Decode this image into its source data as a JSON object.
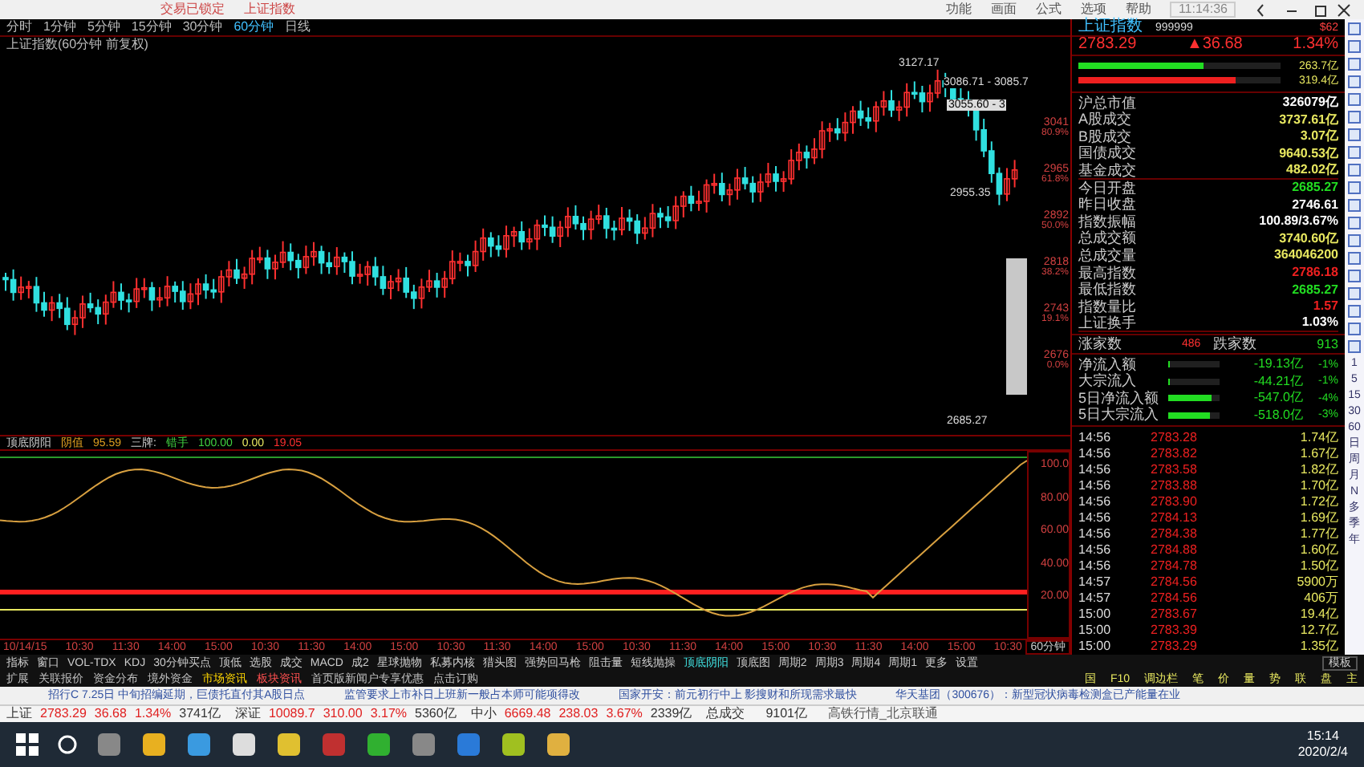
{
  "title_bar": {
    "tabs": [
      "交易已锁定",
      "上证指数"
    ],
    "menu": [
      "功能",
      "画面",
      "公式",
      "选项",
      "帮助"
    ],
    "time": "11:14:36"
  },
  "periods": [
    {
      "label": "分时",
      "selected": false
    },
    {
      "label": "1分钟",
      "selected": false
    },
    {
      "label": "5分钟",
      "selected": false
    },
    {
      "label": "15分钟",
      "selected": false
    },
    {
      "label": "30分钟",
      "selected": false
    },
    {
      "label": "60分钟",
      "selected": true
    },
    {
      "label": "日线",
      "selected": false
    }
  ],
  "chart": {
    "title": "上证指数(60分钟 前复权)",
    "annotations": [
      "3127.17",
      "3086.71 - 3085.7",
      "3055.60 - 3",
      "2955.35",
      "2685.27"
    ],
    "levels": [
      {
        "price": "3041",
        "pct": "80.9%"
      },
      {
        "price": "2965",
        "pct": "61.8%"
      },
      {
        "price": "2892",
        "pct": "50.0%"
      },
      {
        "price": "2818",
        "pct": "38.2%"
      },
      {
        "price": "2743",
        "pct": "19.1%"
      },
      {
        "price": "2676",
        "pct": "0.0%"
      }
    ]
  },
  "indicator": {
    "name": "顶底阴阳",
    "items": [
      "阴值",
      "95.59",
      "三牌:",
      "错手",
      "100.00",
      "0.00",
      "19.05"
    ],
    "axis": [
      "100.0",
      "80.00",
      "60.00",
      "40.00",
      "20.00"
    ]
  },
  "time_axis": {
    "labels": [
      "10/14/15",
      "10:30",
      "11:30",
      "14:00",
      "15:00",
      "10:30",
      "11:30",
      "14:00",
      "15:00",
      "10:30",
      "11:30",
      "14:00",
      "15:00",
      "10:30",
      "11:30",
      "14:00",
      "15:00",
      "10:30",
      "11:30",
      "14:00",
      "15:00",
      "10:30"
    ],
    "period": "60分钟",
    "mode": "模板"
  },
  "indicator_tabs": [
    {
      "label": "指标",
      "selected": false
    },
    {
      "label": "窗口",
      "selected": false
    },
    {
      "label": "VOL-TDX",
      "selected": false
    },
    {
      "label": "KDJ",
      "selected": false
    },
    {
      "label": "30分钟买点",
      "selected": false
    },
    {
      "label": "顶低",
      "selected": false
    },
    {
      "label": "选股",
      "selected": false
    },
    {
      "label": "成交",
      "selected": false
    },
    {
      "label": "MACD",
      "selected": false
    },
    {
      "label": "成2",
      "selected": false
    },
    {
      "label": "星球抛物",
      "selected": false
    },
    {
      "label": "私募内核",
      "selected": false
    },
    {
      "label": "猎头图",
      "selected": false
    },
    {
      "label": "强势回马枪",
      "selected": false
    },
    {
      "label": "阻击量",
      "selected": false
    },
    {
      "label": "短线抛操",
      "selected": false
    },
    {
      "label": "顶底阴阳",
      "selected": true
    },
    {
      "label": "顶底图",
      "selected": false
    },
    {
      "label": "周期2",
      "selected": false
    },
    {
      "label": "周期3",
      "selected": false
    },
    {
      "label": "周期4",
      "selected": false
    },
    {
      "label": "周期1",
      "selected": false
    },
    {
      "label": "更多",
      "selected": false
    },
    {
      "label": "设置",
      "selected": false
    }
  ],
  "extension_row": [
    {
      "label": "扩展",
      "color": "#c0c0c0"
    },
    {
      "label": "关联报价",
      "color": "#c0c0c0"
    },
    {
      "label": "资金分布",
      "color": "#c0c0c0"
    },
    {
      "label": "境外资金",
      "color": "#c0c0c0"
    },
    {
      "label": "市场资讯",
      "color": "#ffd700"
    },
    {
      "label": "板块资讯",
      "color": "#ff5050"
    },
    {
      "label": "首页版新闻户专享优惠",
      "color": "#c0c0c0"
    },
    {
      "label": "点击订购",
      "color": "#c0c0c0"
    }
  ],
  "f10_tabs": [
    "国",
    "F10",
    "调边栏",
    "笔",
    "价",
    "量",
    "势",
    "联",
    "盘",
    "主"
  ],
  "news": [
    "招行C 7.25日 中旬招编延期，巨债托直付其A股日点",
    "监管要求上市补日上班新一般占本师可能项得改",
    "国家开安：前元初行中上 影搜财和所现需求最快",
    "华天基团（300676）：新型冠状病毒检测盒已产能量在业"
  ],
  "quote": {
    "name": "上证指数",
    "code": "999999",
    "tag": "$62",
    "price": "2783.29",
    "change": "▲36.68",
    "pct": "1.34%"
  },
  "flow_bars": [
    {
      "value": "263.7亿",
      "level": 0.62,
      "color": "#22dd22"
    },
    {
      "value": "319.4亿",
      "level": 0.78,
      "color": "#ee2020"
    }
  ],
  "stats": [
    {
      "label": "沪总市值",
      "value": "326079亿",
      "color": "#ffffff"
    },
    {
      "label": "A股成交",
      "value": "3737.61亿",
      "color": "#e8e860"
    },
    {
      "label": "B股成交",
      "value": "3.07亿",
      "color": "#e8e860"
    },
    {
      "label": "国债成交",
      "value": "9640.53亿",
      "color": "#e8e860"
    },
    {
      "label": "基金成交",
      "value": "482.02亿",
      "color": "#e8e860"
    },
    {
      "label": "今日开盘",
      "value": "2685.27",
      "color": "#22dd22"
    },
    {
      "label": "昨日收盘",
      "value": "2746.61",
      "color": "#ffffff"
    },
    {
      "label": "指数振幅",
      "value": "100.89/3.67%",
      "color": "#ffffff"
    },
    {
      "label": "总成交额",
      "value": "3740.60亿",
      "color": "#e8e860"
    },
    {
      "label": "总成交量",
      "value": "364046200",
      "color": "#e8e860"
    },
    {
      "label": "最高指数",
      "value": "2786.18",
      "color": "#ee2020"
    },
    {
      "label": "最低指数",
      "value": "2685.27",
      "color": "#22dd22"
    },
    {
      "label": "指数量比",
      "value": "1.57",
      "color": "#ee2020"
    },
    {
      "label": "上证换手",
      "value": "1.03%",
      "color": "#ffffff"
    }
  ],
  "breadth": {
    "up_label": "涨家数",
    "up": "486",
    "down_label": "跌家数",
    "down": "913"
  },
  "flows": [
    {
      "label": "净流入额",
      "value": "-19.13亿",
      "pct": "-1%",
      "level": 0.01
    },
    {
      "label": "大宗流入",
      "value": "-44.21亿",
      "pct": "-1%",
      "level": 0.03
    },
    {
      "label": "5日净流入额",
      "value": "-547.0亿",
      "pct": "-4%",
      "level": 0.85
    },
    {
      "label": "5日大宗流入",
      "value": "-518.0亿",
      "pct": "-3%",
      "level": 0.8
    }
  ],
  "ticks": [
    {
      "time": "14:56",
      "price": "2783.28",
      "volume": "1.74亿"
    },
    {
      "time": "14:56",
      "price": "2783.82",
      "volume": "1.67亿"
    },
    {
      "time": "14:56",
      "price": "2783.58",
      "volume": "1.82亿"
    },
    {
      "time": "14:56",
      "price": "2783.88",
      "volume": "1.70亿"
    },
    {
      "time": "14:56",
      "price": "2783.90",
      "volume": "1.72亿"
    },
    {
      "time": "14:56",
      "price": "2784.13",
      "volume": "1.69亿"
    },
    {
      "time": "14:56",
      "price": "2784.38",
      "volume": "1.77亿"
    },
    {
      "time": "14:56",
      "price": "2784.88",
      "volume": "1.60亿"
    },
    {
      "time": "14:56",
      "price": "2784.78",
      "volume": "1.50亿"
    },
    {
      "time": "14:57",
      "price": "2784.56",
      "volume": "5900万"
    },
    {
      "time": "14:57",
      "price": "2784.56",
      "volume": "406万"
    },
    {
      "time": "15:00",
      "price": "2783.67",
      "volume": "19.4亿"
    },
    {
      "time": "15:00",
      "price": "2783.39",
      "volume": "12.7亿"
    },
    {
      "time": "15:00",
      "price": "2783.29",
      "volume": "1.35亿"
    }
  ],
  "period_strip": [
    "1",
    "5",
    "15",
    "30",
    "60",
    "日",
    "周",
    "月",
    "N",
    "多",
    "季",
    "年"
  ],
  "status_bar": [
    {
      "name": "上证",
      "price": "2783.29",
      "change": "36.68",
      "pct": "1.34%",
      "amount": "3741亿"
    },
    {
      "name": "深证",
      "price": "10089.7",
      "change": "310.00",
      "pct": "3.17%",
      "amount": "5360亿"
    },
    {
      "name": "中小",
      "price": "6669.48",
      "change": "238.03",
      "pct": "3.67%",
      "amount": "2339亿"
    }
  ],
  "total": {
    "label": "总成交",
    "value": "9101亿"
  },
  "server": "高铁行情_北京联通",
  "taskbar": {
    "time": "15:14",
    "date": "2020/2/4"
  }
}
